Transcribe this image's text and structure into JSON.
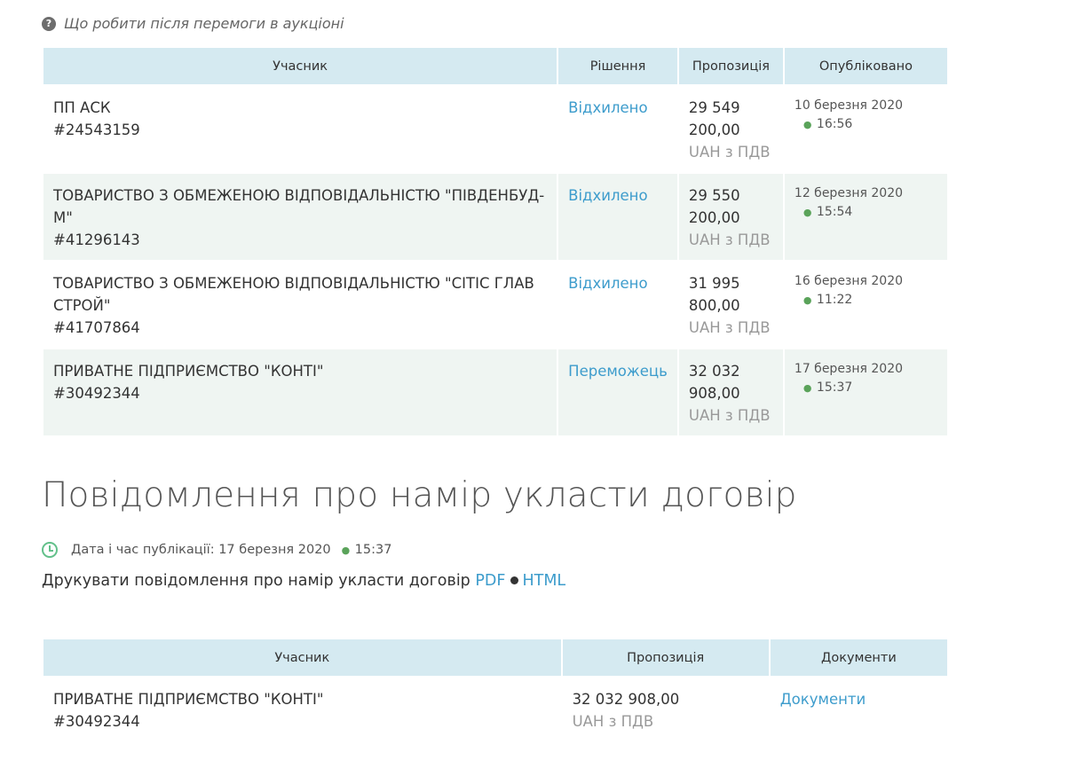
{
  "help": {
    "text": "Що робити після перемоги в аукціоні"
  },
  "bids": {
    "headers": [
      "Учасник",
      "Рішення",
      "Пропозиція",
      "Опубліковано"
    ],
    "rows": [
      {
        "name": "ПП АСК",
        "id": "#24543159",
        "decision": "Відхилено",
        "amount_1": "29 549",
        "amount_2": "200,00",
        "currency": "UAH з ПДВ",
        "date": "10 березня 2020",
        "time": "16:56"
      },
      {
        "name": "ТОВАРИСТВО З ОБМЕЖЕНОЮ ВІДПОВІДАЛЬНІСТЮ \"ПІВДЕНБУД-М\"",
        "id": "#41296143",
        "decision": "Відхилено",
        "amount_1": "29 550",
        "amount_2": "200,00",
        "currency": "UAH з ПДВ",
        "date": "12 березня 2020",
        "time": "15:54"
      },
      {
        "name": "ТОВАРИСТВО З ОБМЕЖЕНОЮ ВІДПОВІДАЛЬНІСТЮ \"СІТІС ГЛАВ СТРОЙ\"",
        "id": "#41707864",
        "decision": "Відхилено",
        "amount_1": "31 995",
        "amount_2": "800,00",
        "currency": "UAH з ПДВ",
        "date": "16 березня 2020",
        "time": "11:22"
      },
      {
        "name": "ПРИВАТНЕ ПІДПРИЄМСТВО \"КОНТІ\"",
        "id": "#30492344",
        "decision": "Переможець",
        "amount_1": "32 032",
        "amount_2": "908,00",
        "currency": "UAH з ПДВ",
        "date": "17 березня 2020",
        "time": "15:37"
      }
    ]
  },
  "notice": {
    "title": "Повідомлення про намір укласти договір",
    "pub_label": "Дата і час публікації: 17 березня 2020",
    "pub_time": "15:37",
    "print_text": "Друкувати повідомлення про намір укласти договір",
    "pdf": "PDF",
    "html": "HTML"
  },
  "contract": {
    "headers": [
      "Учасник",
      "Пропозиція",
      "Документи"
    ],
    "row": {
      "name": "ПРИВАТНЕ ПІДПРИЄМСТВО \"КОНТІ\"",
      "id": "#30492344",
      "amount": "32 032 908,00",
      "currency": "UAH з ПДВ",
      "docs": "Документи"
    }
  },
  "icons": {
    "help": "question-circle-icon",
    "clock": "clock-icon"
  },
  "colors": {
    "link": "#3d9ccc",
    "header_bg": "#d5eaf1",
    "row_alt": "#eff5f2",
    "clock": "#62c08a"
  }
}
